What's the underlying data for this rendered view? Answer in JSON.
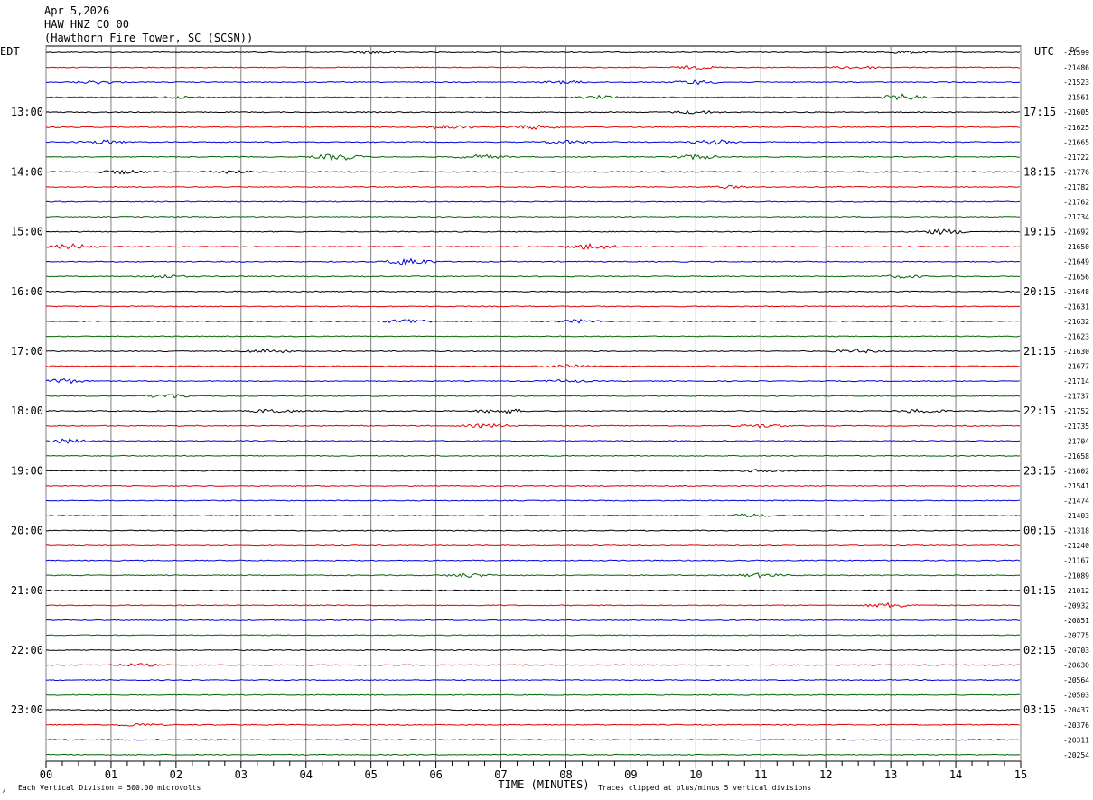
{
  "header": {
    "date": "Apr 5,2026",
    "station": "HAW HNZ CO 00",
    "location": "(Hawthorn Fire Tower, SC (SCSN))"
  },
  "axis_labels": {
    "left_tz": "EDT",
    "right_tz": "UTC",
    "right_dc": "DC",
    "xlabel": "TIME (MINUTES)"
  },
  "footer": {
    "logo": "↗",
    "scale_note": "Each Vertical Division =  500.00 microvolts",
    "clip_note": "Traces clipped at plus/minus 5 vertical divisions"
  },
  "colors": {
    "trace_cycle": [
      "#000000",
      "#e00000",
      "#0000dd",
      "#006600"
    ],
    "grid": "#808080",
    "frame": "#000000"
  },
  "chart_data": {
    "type": "line",
    "subtype": "helicorder",
    "x_ticks": [
      "00",
      "01",
      "02",
      "03",
      "04",
      "05",
      "06",
      "07",
      "08",
      "09",
      "10",
      "11",
      "12",
      "13",
      "14",
      "15"
    ],
    "xlim": [
      0,
      15
    ],
    "trace_count": 48,
    "minutes_per_trace": 15,
    "left_hour_labels": [
      "13:00",
      "14:00",
      "15:00",
      "16:00",
      "17:00",
      "18:00",
      "19:00",
      "20:00",
      "21:00",
      "22:00",
      "23:00"
    ],
    "right_hour_labels": [
      "17:15",
      "18:15",
      "19:15",
      "20:15",
      "21:15",
      "22:15",
      "23:15",
      "00:15",
      "01:15",
      "02:15",
      "03:15"
    ],
    "hour_label_first_trace": 4,
    "traces_per_hour": 4,
    "dc_offsets": [
      "-21399",
      "-21486",
      "-21523",
      "-21561",
      "-21605",
      "-21625",
      "-21665",
      "-21722",
      "-21776",
      "-21782",
      "-21762",
      "-21734",
      "-21692",
      "-21650",
      "-21649",
      "-21656",
      "-21648",
      "-21631",
      "-21632",
      "-21623",
      "-21630",
      "-21677",
      "-21714",
      "-21737",
      "-21752",
      "-21735",
      "-21704",
      "-21658",
      "-21602",
      "-21541",
      "-21474",
      "-21403",
      "-21318",
      "-21240",
      "-21167",
      "-21089",
      "-21012",
      "-20932",
      "-20851",
      "-20775",
      "-20703",
      "-20630",
      "-20564",
      "-20503",
      "-20437",
      "-20376",
      "-20311",
      "-20254"
    ],
    "events": [
      {
        "trace": 0,
        "minute": 5.1,
        "amp": 1.2
      },
      {
        "trace": 0,
        "minute": 13.2,
        "amp": 1.0
      },
      {
        "trace": 1,
        "minute": 10.0,
        "amp": 1.3
      },
      {
        "trace": 1,
        "minute": 12.5,
        "amp": 1.2
      },
      {
        "trace": 2,
        "minute": 0.8,
        "amp": 1.4
      },
      {
        "trace": 2,
        "minute": 8.0,
        "amp": 1.2
      },
      {
        "trace": 2,
        "minute": 10.0,
        "amp": 1.6
      },
      {
        "trace": 3,
        "minute": 2.0,
        "amp": 1.0
      },
      {
        "trace": 3,
        "minute": 8.5,
        "amp": 1.3
      },
      {
        "trace": 3,
        "minute": 13.2,
        "amp": 2.4
      },
      {
        "trace": 4,
        "minute": 10.0,
        "amp": 1.4
      },
      {
        "trace": 5,
        "minute": 6.2,
        "amp": 2.0
      },
      {
        "trace": 5,
        "minute": 7.5,
        "amp": 1.8
      },
      {
        "trace": 6,
        "minute": 0.9,
        "amp": 1.6
      },
      {
        "trace": 6,
        "minute": 8.0,
        "amp": 1.6
      },
      {
        "trace": 6,
        "minute": 10.3,
        "amp": 2.0
      },
      {
        "trace": 7,
        "minute": 4.5,
        "amp": 2.8
      },
      {
        "trace": 7,
        "minute": 6.7,
        "amp": 1.8
      },
      {
        "trace": 7,
        "minute": 10.0,
        "amp": 2.0
      },
      {
        "trace": 8,
        "minute": 1.2,
        "amp": 1.6
      },
      {
        "trace": 8,
        "minute": 2.8,
        "amp": 1.3
      },
      {
        "trace": 9,
        "minute": 10.5,
        "amp": 1.0
      },
      {
        "trace": 12,
        "minute": 13.8,
        "amp": 2.2
      },
      {
        "trace": 13,
        "minute": 0.4,
        "amp": 2.2
      },
      {
        "trace": 13,
        "minute": 8.4,
        "amp": 2.6
      },
      {
        "trace": 14,
        "minute": 5.6,
        "amp": 3.2
      },
      {
        "trace": 15,
        "minute": 1.8,
        "amp": 1.4
      },
      {
        "trace": 15,
        "minute": 13.2,
        "amp": 1.2
      },
      {
        "trace": 18,
        "minute": 5.6,
        "amp": 2.0
      },
      {
        "trace": 18,
        "minute": 8.2,
        "amp": 1.4
      },
      {
        "trace": 20,
        "minute": 3.4,
        "amp": 1.8
      },
      {
        "trace": 20,
        "minute": 12.5,
        "amp": 1.4
      },
      {
        "trace": 21,
        "minute": 8.0,
        "amp": 1.2
      },
      {
        "trace": 22,
        "minute": 0.2,
        "amp": 2.4
      },
      {
        "trace": 22,
        "minute": 8.0,
        "amp": 1.0
      },
      {
        "trace": 23,
        "minute": 1.9,
        "amp": 1.8
      },
      {
        "trace": 24,
        "minute": 3.5,
        "amp": 1.8
      },
      {
        "trace": 24,
        "minute": 7.0,
        "amp": 2.2
      },
      {
        "trace": 24,
        "minute": 13.5,
        "amp": 1.8
      },
      {
        "trace": 25,
        "minute": 6.8,
        "amp": 1.6
      },
      {
        "trace": 25,
        "minute": 11.0,
        "amp": 1.4
      },
      {
        "trace": 26,
        "minute": 0.3,
        "amp": 1.8
      },
      {
        "trace": 28,
        "minute": 11.1,
        "amp": 1.4
      },
      {
        "trace": 31,
        "minute": 10.8,
        "amp": 1.4
      },
      {
        "trace": 35,
        "minute": 6.5,
        "amp": 1.6
      },
      {
        "trace": 35,
        "minute": 11.0,
        "amp": 1.6
      },
      {
        "trace": 37,
        "minute": 13.0,
        "amp": 2.0
      },
      {
        "trace": 41,
        "minute": 1.4,
        "amp": 1.2
      },
      {
        "trace": 45,
        "minute": 1.4,
        "amp": 1.2
      }
    ]
  }
}
